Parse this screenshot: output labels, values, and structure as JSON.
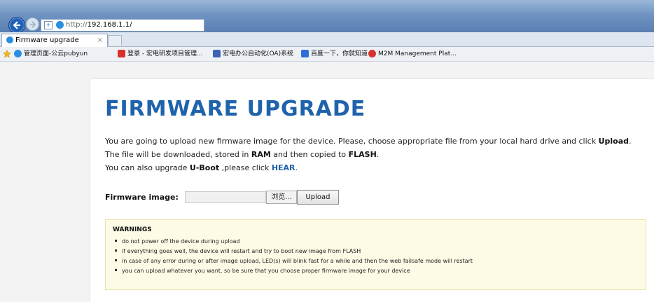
{
  "browser": {
    "address": {
      "http": "http://",
      "host": "192.168.1.1/"
    },
    "tab": {
      "title": "Firmware upgrade",
      "close": "×"
    },
    "favorites": [
      {
        "label": "管理页面-公云pubyun",
        "icon": "globe-icon",
        "color": "#2a8ee0"
      },
      {
        "label": "登录 - 宏电研发项目管理...",
        "icon": "project-icon",
        "color": "#d9302c"
      },
      {
        "label": "宏电办公自动化(OA)系统",
        "icon": "oa-icon",
        "color": "#3b64b4"
      },
      {
        "label": "百度一下，你就知道",
        "icon": "baidu-icon",
        "color": "#2d6fd6"
      },
      {
        "label": "M2M Management Plat...",
        "icon": "m2m-icon",
        "color": "#d9302c"
      }
    ]
  },
  "page": {
    "title": "FIRMWARE UPGRADE",
    "line1": {
      "pre": "You are going to upload new firmware image for the device. Please, choose appropriate file from your local hard drive and click ",
      "bold": "Upload",
      "post": "."
    },
    "line2": {
      "pre": "The file will be downloaded, stored in ",
      "bold1": "RAM",
      "mid": " and then copied to ",
      "bold2": "FLASH",
      "post": "."
    },
    "line3": {
      "pre": "You can also upgrade ",
      "bold": "U-Boot",
      "mid": " ,please click ",
      "link": "HEAR",
      "post": "."
    },
    "form": {
      "label": "Firmware image:",
      "browse": "浏览...",
      "upload": "Upload"
    },
    "warnings": {
      "title": "WARNINGS",
      "items": [
        "do not power off the device during upload",
        "if everything goes well, the device will restart and try to boot new image from FLASH",
        "in case of any error during or after image upload, LED(s) will blink fast for a while and then the web failsafe mode will restart",
        "you can upload whatever you want, so be sure that you choose proper firmware image for your device"
      ]
    }
  }
}
